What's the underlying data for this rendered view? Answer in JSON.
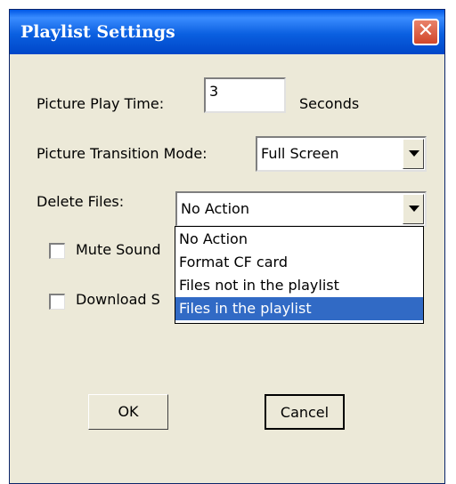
{
  "window": {
    "title": "Playlist Settings",
    "close_symbol": "✕"
  },
  "picture_play_time": {
    "label": "Picture Play Time:",
    "value": "3",
    "unit": "Seconds"
  },
  "transition_mode": {
    "label": "Picture Transition Mode:",
    "value": "Full Screen"
  },
  "delete_files": {
    "label": "Delete Files:",
    "value": "No Action",
    "options": [
      "No Action",
      "Format CF card",
      "Files not in the playlist",
      "Files in the playlist"
    ],
    "highlighted_index": 3
  },
  "mute_sound": {
    "label": "Mute Sound",
    "checked": false
  },
  "download": {
    "label": "Download S",
    "checked": false
  },
  "buttons": {
    "ok": "OK",
    "cancel": "Cancel"
  },
  "colors": {
    "titlebar": "#0058e6",
    "highlight": "#316ac5",
    "dialog_bg": "#ece9d8",
    "close_button": "#d1462a"
  }
}
